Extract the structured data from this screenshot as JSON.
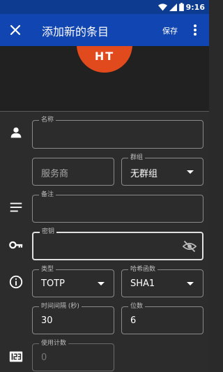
{
  "status": {
    "time": "9:16"
  },
  "appbar": {
    "title": "添加新的条目",
    "save_label": "保存"
  },
  "header": {
    "icon_text": "HT"
  },
  "form": {
    "name": {
      "label": "名称",
      "value": ""
    },
    "issuer": {
      "placeholder": "服务商"
    },
    "group": {
      "label": "群组",
      "value": "无群组"
    },
    "note": {
      "label": "备注",
      "value": ""
    },
    "secret": {
      "label": "密钥",
      "value": ""
    },
    "type": {
      "label": "类型",
      "value": "TOTP"
    },
    "algorithm": {
      "label": "哈希函数",
      "value": "SHA1"
    },
    "period": {
      "label": "时间间隔 (秒)",
      "value": "30"
    },
    "digits": {
      "label": "位数",
      "value": "6"
    },
    "counter": {
      "label": "使用计数",
      "value": "0"
    }
  },
  "icons": [
    "close-icon",
    "more-vert-icon",
    "wifi-icon",
    "signal-icon",
    "battery-icon",
    "person-icon",
    "notes-icon",
    "key-icon",
    "info-icon",
    "counter-icon",
    "visibility-off-icon",
    "chevron-down-icon"
  ]
}
